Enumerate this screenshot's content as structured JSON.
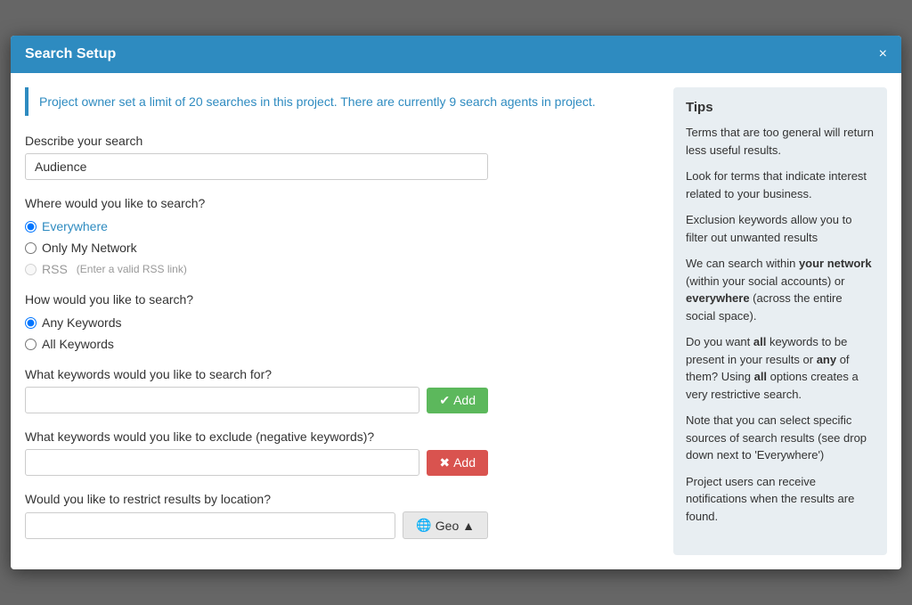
{
  "modal": {
    "title": "Search Setup",
    "close_label": "×"
  },
  "banner": {
    "text": "Project owner set a limit of 20 searches in this project. There are currently 9 search agents in project."
  },
  "form": {
    "describe_label": "Describe your search",
    "describe_placeholder": "Audience",
    "describe_value": "Audience",
    "where_label": "Where would you like to search?",
    "where_options": [
      {
        "id": "everywhere",
        "label": "Everywhere",
        "checked": true,
        "disabled": false,
        "style": "blue"
      },
      {
        "id": "only_my_network",
        "label": "Only My Network",
        "checked": false,
        "disabled": false,
        "style": "normal"
      },
      {
        "id": "rss",
        "label": "RSS",
        "checked": false,
        "disabled": true,
        "style": "disabled",
        "hint": "(Enter a valid RSS link)"
      }
    ],
    "how_label": "How would you like to search?",
    "how_options": [
      {
        "id": "any_keywords",
        "label": "Any Keywords",
        "checked": true,
        "disabled": false
      },
      {
        "id": "all_keywords",
        "label": "All Keywords",
        "checked": false,
        "disabled": false
      }
    ],
    "keywords_label": "What keywords would you like to search for?",
    "keywords_placeholder": "",
    "keywords_add_label": "✔ Add",
    "exclude_label": "What keywords would you like to exclude (negative keywords)?",
    "exclude_placeholder": "",
    "exclude_add_label": "✖ Add",
    "location_label": "Would you like to restrict results by location?",
    "location_placeholder": "",
    "geo_label": "🌐 Geo ▲"
  },
  "tips": {
    "title": "Tips",
    "items": [
      "Terms that are too general will return less useful results.",
      "Look for terms that indicate interest related to your business.",
      "Exclusion keywords allow you to filter out unwanted results",
      "We can search within your network (within your social accounts) or everywhere (across the entire social space).",
      "Do you want all keywords to be present in your results or any of them? Using all options creates a very restrictive search.",
      "Note that you can select specific sources of search results (see drop down next to 'Everywhere')",
      "Project users can receive notifications when the results are found."
    ]
  }
}
